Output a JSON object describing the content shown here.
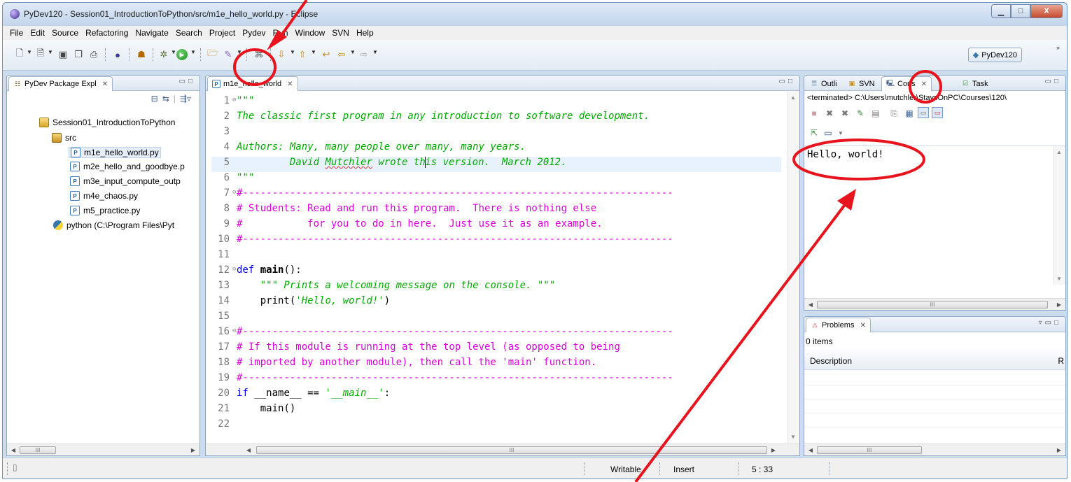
{
  "window": {
    "title": "PyDev120 - Session01_IntroductionToPython/src/m1e_hello_world.py - Eclipse",
    "minimize_glyph": "▁",
    "maximize_glyph": "□",
    "close_glyph": "X"
  },
  "menu": [
    "File",
    "Edit",
    "Source",
    "Refactoring",
    "Navigate",
    "Search",
    "Project",
    "Pydev",
    "Run",
    "Window",
    "SVN",
    "Help"
  ],
  "toolbar": {
    "run_glyph": "▶",
    "perspective_label": "PyDev120",
    "chevron": "»"
  },
  "package_explorer": {
    "tab_label": "PyDev Package Expl",
    "tab_close": "✕",
    "project": "Session01_IntroductionToPython",
    "folder": "src",
    "files": [
      "m1e_hello_world.py",
      "m2e_hello_and_goodbye.p",
      "m3e_input_compute_outp",
      "m4e_chaos.py",
      "m5_practice.py"
    ],
    "interpreter": "python  (C:\\Program Files\\Pyt"
  },
  "editor": {
    "tab_label": "m1e_hello_world",
    "tab_close": "✕",
    "lines": [
      {
        "n": "1",
        "fold": "⊖",
        "segs": [
          {
            "t": "\"\"\"",
            "c": "c-str"
          }
        ]
      },
      {
        "n": "2",
        "segs": [
          {
            "t": "The classic first program in any introduction to software development.",
            "c": "c-str"
          }
        ]
      },
      {
        "n": "3",
        "segs": []
      },
      {
        "n": "4",
        "segs": [
          {
            "t": "Authors: Many, many people over many, many years.",
            "c": "c-str"
          }
        ]
      },
      {
        "n": "5",
        "current": true,
        "segs": [
          {
            "t": "         ",
            "c": "c-str"
          },
          {
            "t": "David",
            "c": "c-str"
          },
          {
            "t": " ",
            "c": "c-str"
          },
          {
            "t": "Mutchler",
            "c": "c-str squiggle"
          },
          {
            "t": " wrote th",
            "c": "c-str"
          },
          {
            "t": "",
            "c": "cursor"
          },
          {
            "t": "is version.  March 2012.",
            "c": "c-str"
          }
        ]
      },
      {
        "n": "6",
        "segs": [
          {
            "t": "\"\"\"",
            "c": "c-str"
          }
        ]
      },
      {
        "n": "7",
        "fold": "⊖",
        "segs": [
          {
            "t": "#-------------------------------------------------------------------------",
            "c": "c-cmt"
          }
        ]
      },
      {
        "n": "8",
        "segs": [
          {
            "t": "# Students: Read and run this program.  There is nothing else",
            "c": "c-cmt"
          }
        ]
      },
      {
        "n": "9",
        "segs": [
          {
            "t": "#           for you to do in here.  Just use it as an example.",
            "c": "c-cmt"
          }
        ]
      },
      {
        "n": "10",
        "segs": [
          {
            "t": "#-------------------------------------------------------------------------",
            "c": "c-cmt"
          }
        ]
      },
      {
        "n": "11",
        "segs": []
      },
      {
        "n": "12",
        "fold": "⊖",
        "segs": [
          {
            "t": "def ",
            "c": "c-kw"
          },
          {
            "t": "main",
            "c": "c-fn"
          },
          {
            "t": "():",
            "c": "c-plain"
          }
        ]
      },
      {
        "n": "13",
        "segs": [
          {
            "t": "    ",
            "c": "c-plain"
          },
          {
            "t": "\"\"\" Prints a welcoming message on the console. \"\"\"",
            "c": "c-str"
          }
        ]
      },
      {
        "n": "14",
        "segs": [
          {
            "t": "    print(",
            "c": "c-plain"
          },
          {
            "t": "'Hello, world!'",
            "c": "c-str"
          },
          {
            "t": ")",
            "c": "c-plain"
          }
        ]
      },
      {
        "n": "15",
        "segs": []
      },
      {
        "n": "16",
        "fold": "⊖",
        "segs": [
          {
            "t": "#-------------------------------------------------------------------------",
            "c": "c-cmt"
          }
        ]
      },
      {
        "n": "17",
        "segs": [
          {
            "t": "# If this module is running at the top level (as opposed to being",
            "c": "c-cmt"
          }
        ]
      },
      {
        "n": "18",
        "segs": [
          {
            "t": "# imported by another module), then call the 'main' function.",
            "c": "c-cmt"
          }
        ]
      },
      {
        "n": "19",
        "segs": [
          {
            "t": "#-------------------------------------------------------------------------",
            "c": "c-cmt"
          }
        ]
      },
      {
        "n": "20",
        "segs": [
          {
            "t": "if ",
            "c": "c-kw"
          },
          {
            "t": "__name__ == ",
            "c": "c-plain"
          },
          {
            "t": "'__main__'",
            "c": "c-str"
          },
          {
            "t": ":",
            "c": "c-plain"
          }
        ]
      },
      {
        "n": "21",
        "segs": [
          {
            "t": "    main()",
            "c": "c-plain"
          }
        ]
      },
      {
        "n": "22",
        "segs": []
      }
    ]
  },
  "right_tabs": {
    "outline": "Outli",
    "svn": "SVN",
    "console": "Cons",
    "tasks": "Task",
    "close": "✕"
  },
  "console": {
    "path": "<terminated> C:\\Users\\mutchler\\StaysOnPC\\Courses\\120\\",
    "output": "Hello, world!"
  },
  "problems": {
    "tab_label": "Problems",
    "tab_close": "✕",
    "count": "0 items",
    "col_description": "Description",
    "col_resource": "R"
  },
  "statusbar": {
    "writable": "Writable",
    "insert_mode": "Insert",
    "position": "5 : 33"
  },
  "scroll": {
    "thumb_grip": "III"
  },
  "annotation_color": "#e8141d"
}
